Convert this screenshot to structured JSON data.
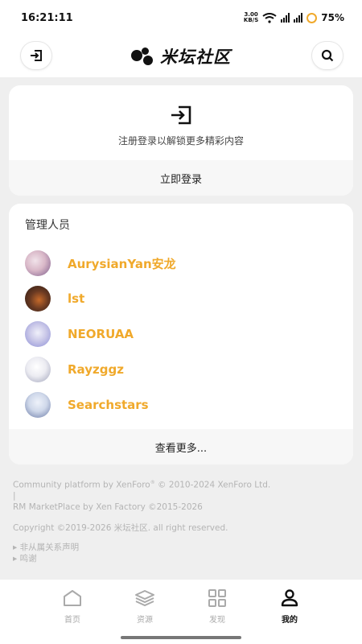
{
  "status_bar": {
    "time": "16:21:11",
    "net_speed_value": "3.00",
    "net_speed_unit": "KB/S",
    "battery": "75%"
  },
  "header": {
    "title": "米坛社区",
    "left_icon": "login-icon",
    "right_icon": "search-icon"
  },
  "login_card": {
    "icon": "login-icon",
    "hint": "注册登录以解锁更多精彩内容",
    "button_label": "立即登录"
  },
  "staff": {
    "title": "管理人员",
    "members": [
      {
        "name": "AurysianYan安龙",
        "avatar_colors": [
          "#d9b8c8",
          "#7b5a8a"
        ]
      },
      {
        "name": "lst",
        "avatar_colors": [
          "#4a2a20",
          "#c66a2a"
        ]
      },
      {
        "name": "NEORUAA",
        "avatar_colors": [
          "#c9c7e8",
          "#8c8fd6"
        ]
      },
      {
        "name": "Rayzggz",
        "avatar_colors": [
          "#ececf2",
          "#9da0b8"
        ]
      },
      {
        "name": "Searchstars",
        "avatar_colors": [
          "#cfd8ea",
          "#6a7aa6"
        ]
      }
    ],
    "more_label": "查看更多..."
  },
  "footer": {
    "line1_prefix": "Community platform by XenForo",
    "line1_reg": "®",
    "line1_suffix": " © 2010-2024 XenForo Ltd.",
    "separator": "|",
    "line2": "RM MarketPlace by Xen Factory ©2015-2026",
    "line3": "Copyright ©2019-2026 米坛社区. all right reserved.",
    "link1": "▸ 非从属关系声明",
    "link2": "▸ 鸣谢"
  },
  "tabbar": {
    "tabs": [
      {
        "label": "首页",
        "icon": "home-icon"
      },
      {
        "label": "资源",
        "icon": "layers-icon"
      },
      {
        "label": "发现",
        "icon": "grid-icon"
      },
      {
        "label": "我的",
        "icon": "user-icon"
      }
    ],
    "active_index": 3
  },
  "colors": {
    "accent": "#f0a92b",
    "background": "#efefef"
  }
}
